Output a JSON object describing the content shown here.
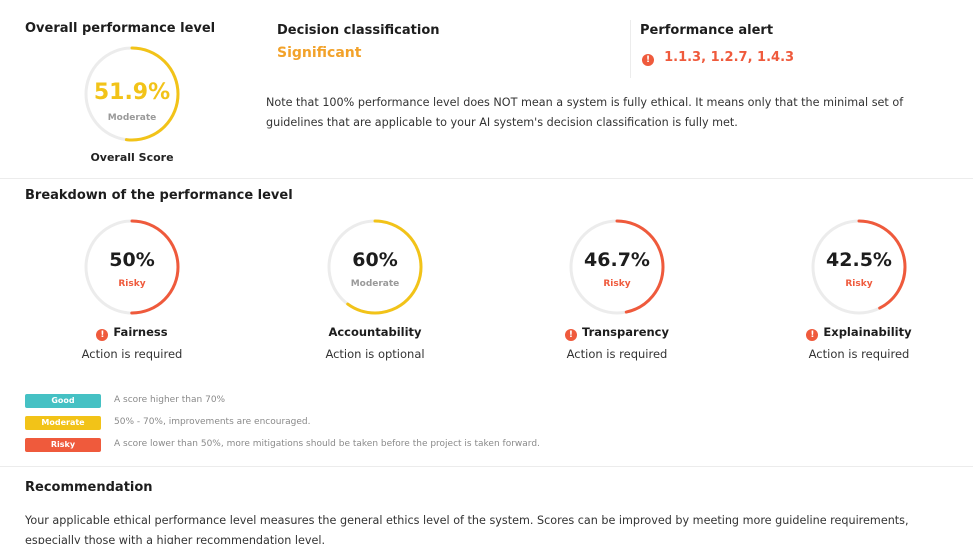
{
  "overall": {
    "title": "Overall performance level",
    "score_value": "51.9%",
    "score_fraction": 0.519,
    "score_level": "Moderate",
    "score_caption": "Overall Score",
    "color": "#f2c318"
  },
  "decision": {
    "title": "Decision classification",
    "value": "Significant",
    "color": "#f2a22a"
  },
  "alert": {
    "title": "Performance alert",
    "items": "1.1.3, 1.2.7, 1.4.3",
    "icon": "exclamation-circle-icon",
    "icon_glyph": "!",
    "color": "#ef5a3c"
  },
  "note": "Note that 100% performance level does NOT mean a system is fully ethical. It means only that the minimal set of guidelines that are applicable to your AI system's decision classification is fully met.",
  "breakdown": {
    "title": "Breakdown of the performance level",
    "categories": [
      {
        "name": "Fairness",
        "value": "50%",
        "fraction": 0.5,
        "level": "Risky",
        "action": "Action is required",
        "alert": true,
        "color": "#ef5a3c"
      },
      {
        "name": "Accountability",
        "value": "60%",
        "fraction": 0.6,
        "level": "Moderate",
        "action": "Action is optional",
        "alert": false,
        "color": "#f2c318"
      },
      {
        "name": "Transparency",
        "value": "46.7%",
        "fraction": 0.467,
        "level": "Risky",
        "action": "Action is required",
        "alert": true,
        "color": "#ef5a3c"
      },
      {
        "name": "Explainability",
        "value": "42.5%",
        "fraction": 0.425,
        "level": "Risky",
        "action": "Action is required",
        "alert": true,
        "color": "#ef5a3c"
      }
    ]
  },
  "legend": [
    {
      "label": "Good",
      "text": "A score higher than 70%",
      "color": "#45c1c4"
    },
    {
      "label": "Moderate",
      "text": "50% - 70%, improvements are encouraged.",
      "color": "#f2c318"
    },
    {
      "label": "Risky",
      "text": "A score lower than 50%, more mitigations should be taken before the project is taken forward.",
      "color": "#ef5a3c"
    }
  ],
  "recommendation": {
    "title": "Recommendation",
    "text": "Your applicable ethical performance level measures the general ethics level of the system. Scores can be improved by meeting more guideline requirements, especially those with a higher recommendation level."
  },
  "colors": {
    "track": "#ececec",
    "moderate_text": "#9a9a9a",
    "risky_text": "#ef5a3c"
  }
}
